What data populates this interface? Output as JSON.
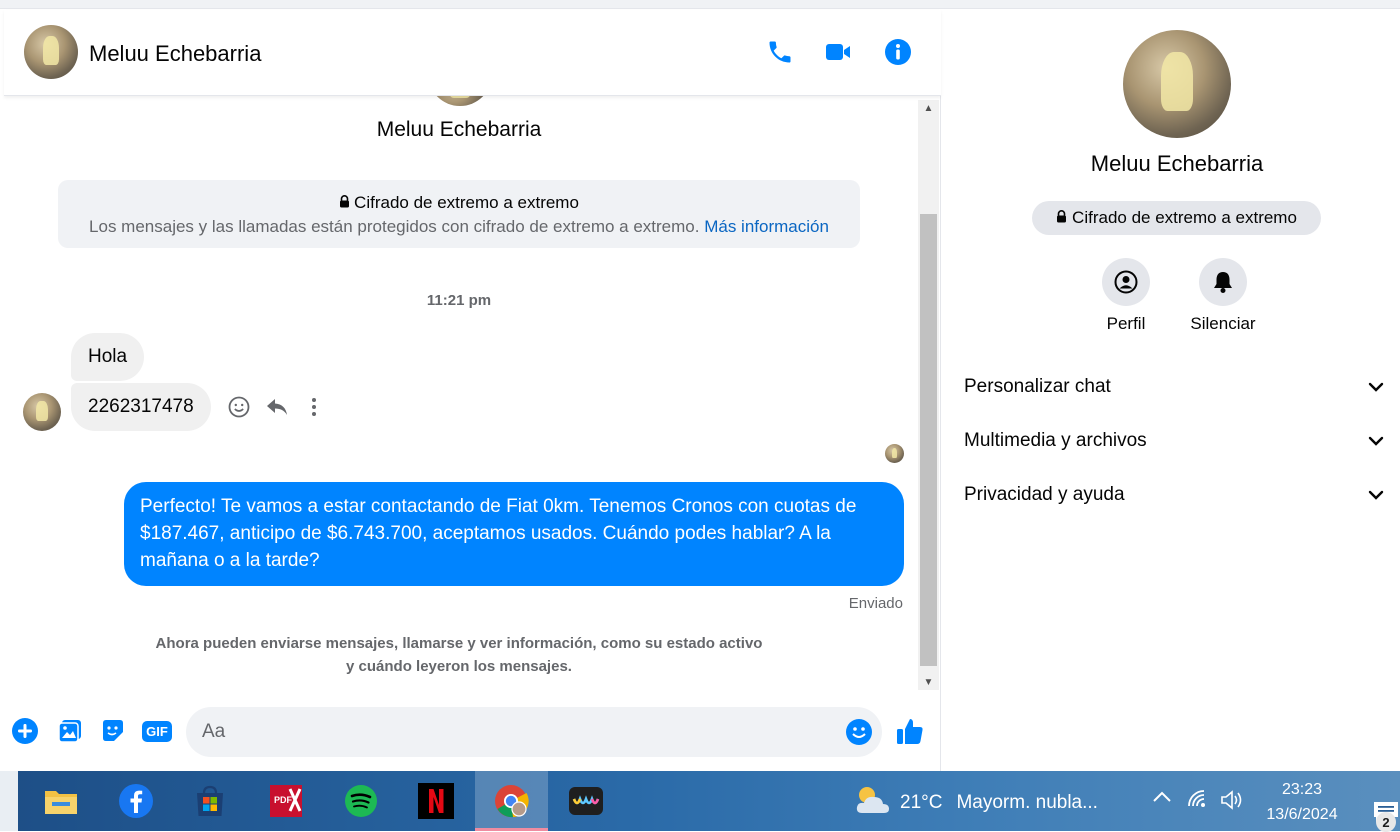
{
  "contact": {
    "name": "Meluu Echebarria"
  },
  "colors": {
    "accent": "#0084ff",
    "link": "#0a66c2"
  },
  "header": {
    "icons": [
      "phone-icon",
      "video-camera-icon",
      "info-icon"
    ]
  },
  "encryption": {
    "title": "Cifrado de extremo a extremo",
    "description": "Los mensajes y las llamadas están protegidos con cifrado de extremo a extremo.",
    "link": "Más información"
  },
  "conversation": {
    "timestamp": "11:21 pm",
    "incoming": [
      {
        "text": "Hola"
      },
      {
        "text": "2262317478"
      }
    ],
    "outgoing": {
      "text": "Perfecto! Te vamos a estar contactando de Fiat 0km. Tenemos Cronos con cuotas de $187.467, anticipo de $6.743.700, aceptamos usados. Cuándo podes hablar? A la mañana o a la tarde?",
      "status": "Enviado"
    },
    "note_line1": "Ahora pueden enviarse mensajes, llamarse y ver información, como su estado activo",
    "note_line2": "y cuándo leyeron los mensajes."
  },
  "composer": {
    "placeholder": "Aa",
    "gif_label": "GIF"
  },
  "info_panel": {
    "encryption_pill": "Cifrado de extremo a extremo",
    "actions": [
      {
        "label": "Perfil",
        "icon": "profile-icon"
      },
      {
        "label": "Silenciar",
        "icon": "bell-icon"
      }
    ],
    "sections": [
      {
        "label": "Personalizar chat"
      },
      {
        "label": "Multimedia y archivos"
      },
      {
        "label": "Privacidad y ayuda"
      }
    ]
  },
  "taskbar": {
    "weather_temp": "21°C",
    "weather_desc": "Mayorm. nubla...",
    "time": "23:23",
    "date": "13/6/2024",
    "notification_count": "2",
    "apps": [
      "file-explorer",
      "facebook",
      "microsoft-store",
      "pdf-editor",
      "spotify",
      "netflix",
      "chrome",
      "app"
    ]
  }
}
